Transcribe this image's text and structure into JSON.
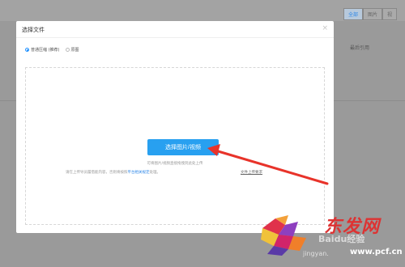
{
  "background": {
    "tabs": [
      "全部",
      "图片",
      "视"
    ],
    "active_tab": 0,
    "col_header": "最后引用"
  },
  "dialog": {
    "title": "选择文件",
    "close_glyph": "×",
    "options": [
      {
        "label": "普通压缩 (推荐)",
        "checked": true
      },
      {
        "label": "原图",
        "checked": false
      }
    ],
    "select_button": "选择图片/视频",
    "hint_line1": "可将图片/视频直接拖拽到此处上传",
    "hint_line2_prefix": "请在上传导员履借能内容，否则将按照",
    "hint_line2_link": "平台相关规定",
    "hint_line2_suffix": "处理。",
    "file_requirements_link": "文件上传要求"
  },
  "watermark": {
    "brand": "东发网",
    "baidu": "Baidu经验",
    "url1": "jingyan.",
    "url2": "www.pcf.cn"
  },
  "colors": {
    "accent": "#28a0f0",
    "arrow": "#e8332a"
  }
}
